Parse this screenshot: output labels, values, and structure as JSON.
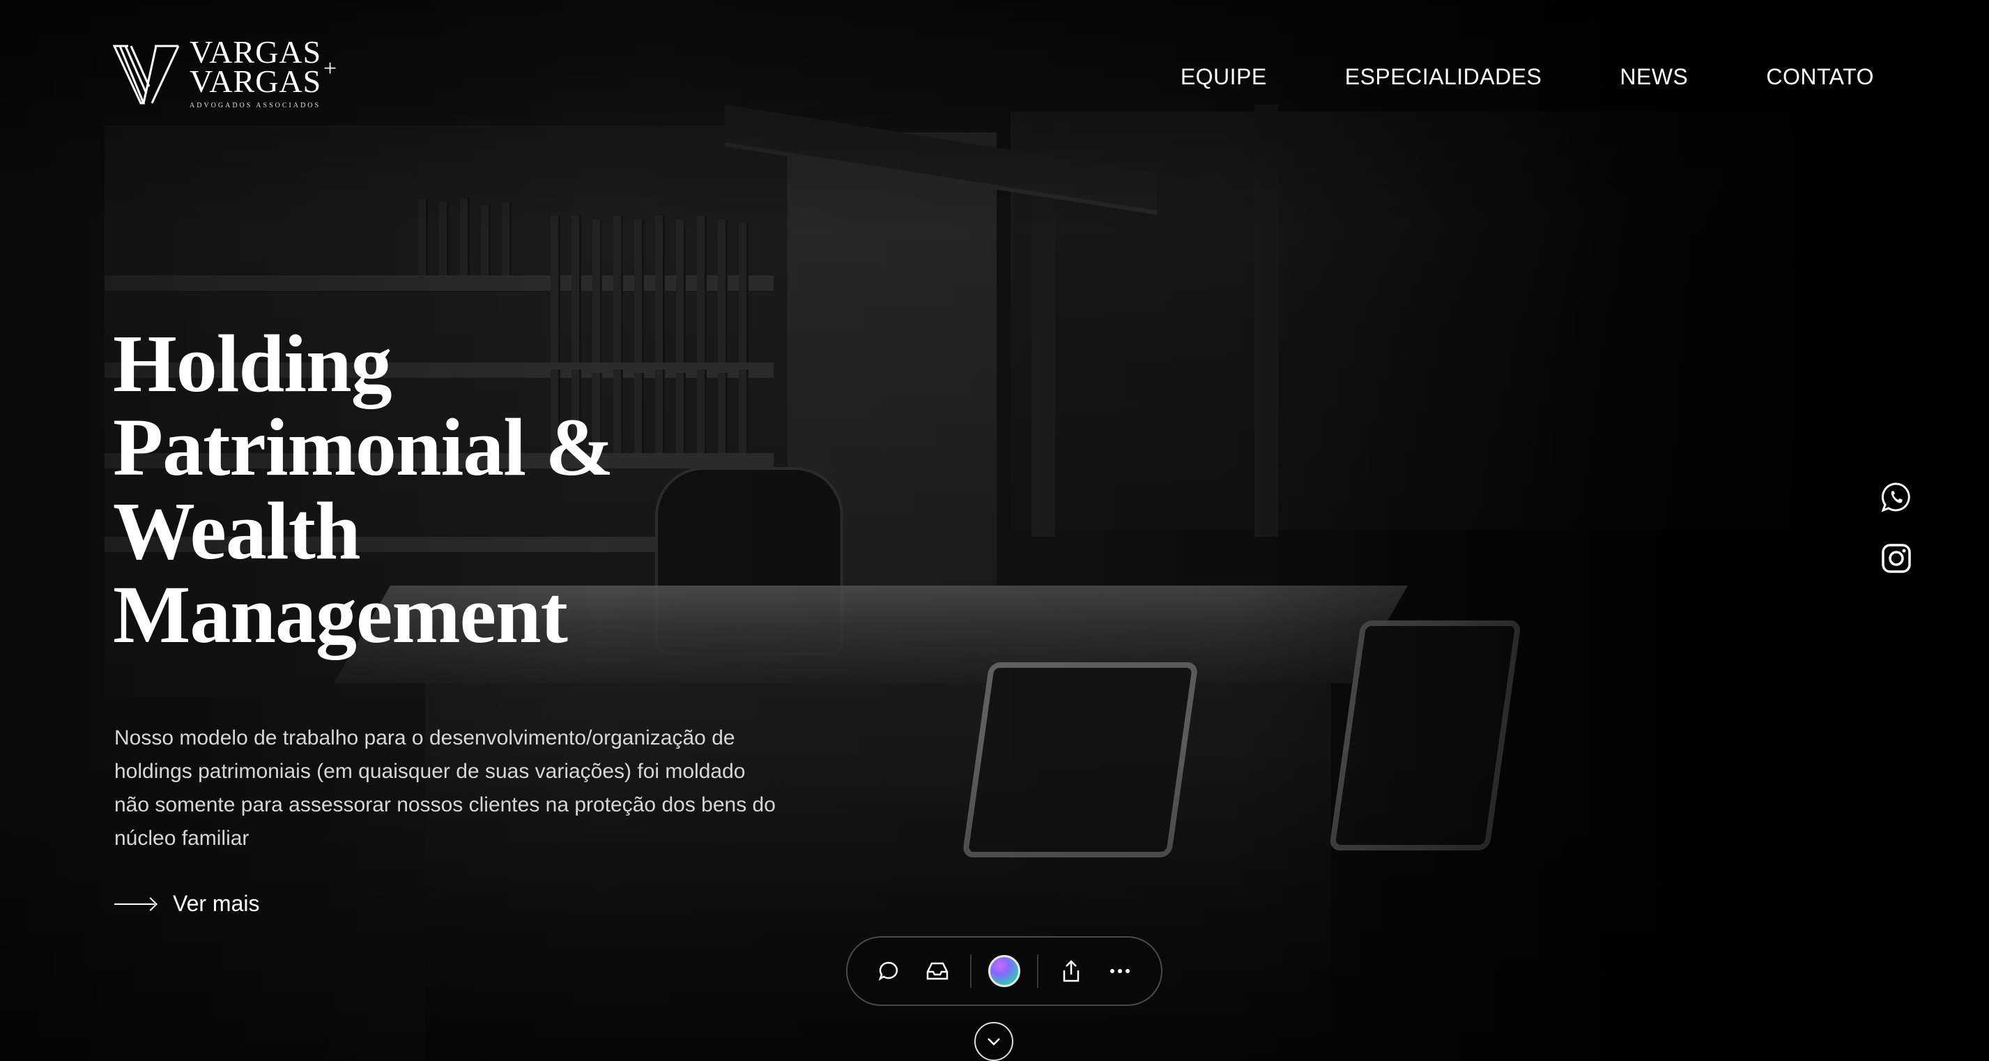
{
  "brand": {
    "line1": "VARGAS",
    "line2": "VARGAS",
    "plus": "+",
    "tagline": "ADVOGADOS ASSOCIADOS",
    "logo_icon": "v-monogram-icon"
  },
  "nav": {
    "items": [
      {
        "label": "EQUIPE"
      },
      {
        "label": "ESPECIALIDADES"
      },
      {
        "label": "NEWS"
      },
      {
        "label": "CONTATO"
      }
    ]
  },
  "hero": {
    "title_lines": [
      "Holding",
      "Patrimonial &",
      "Wealth",
      "Management"
    ],
    "description": "Nosso modelo de trabalho para o desenvolvimento/organização de holdings patrimoniais (em quaisquer de suas variações) foi moldado não somente para assessorar nossos clientes na proteção dos bens do núcleo familiar",
    "cta_label": "Ver mais"
  },
  "social": [
    {
      "icon": "whatsapp-icon"
    },
    {
      "icon": "instagram-icon"
    }
  ],
  "toolbar": {
    "buttons": [
      "chat-bubble-icon",
      "inbox-icon",
      "avatar-orb",
      "share-icon",
      "more-icon"
    ]
  },
  "scroll": {
    "icon": "chevron-down-icon"
  },
  "colors": {
    "background": "#000000",
    "text": "#ffffff",
    "muted_text": "#d6d6d6",
    "toolbar_border": "#4a4a4a"
  }
}
